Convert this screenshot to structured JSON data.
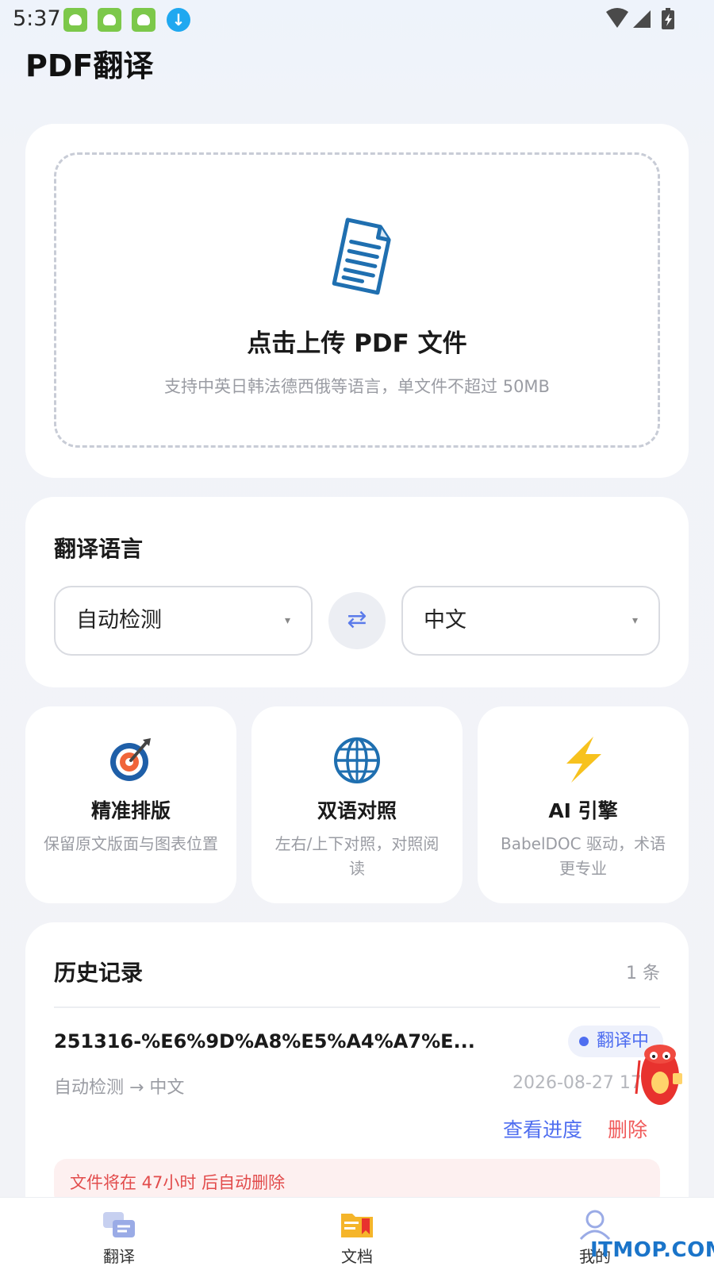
{
  "status_bar": {
    "time": "5:37"
  },
  "header": {
    "title": "PDF翻译"
  },
  "upload": {
    "title": "点击上传 PDF 文件",
    "subtitle": "支持中英日韩法德西俄等语言，单文件不超过 50MB"
  },
  "language": {
    "heading": "翻译语言",
    "source": "自动检测",
    "target": "中文",
    "caret": "▾",
    "swap_symbol": "⇄"
  },
  "features": [
    {
      "title": "精准排版",
      "desc": "保留原文版面与图表位置",
      "icon": "target-icon"
    },
    {
      "title": "双语对照",
      "desc": "左右/上下对照，对照阅读",
      "icon": "globe-icon"
    },
    {
      "title": "AI 引擎",
      "desc": "BabelDOC 驱动，术语更专业",
      "icon": "lightning-icon"
    }
  ],
  "history": {
    "title": "历史记录",
    "count": "1 条",
    "items": [
      {
        "file_name": "251316-%E6%9D%A8%E5%A4%A7%E...",
        "status": "翻译中",
        "langs": "自动检测 → 中文",
        "date": "2026-08-27 17",
        "view_label": "查看进度",
        "delete_label": "删除",
        "warning": "文件将在 47小时 后自动删除"
      }
    ]
  },
  "bottom_nav": [
    {
      "label": "翻译",
      "icon": "translate-icon"
    },
    {
      "label": "文档",
      "icon": "document-folder-icon"
    },
    {
      "label": "我的",
      "icon": "profile-icon"
    }
  ],
  "watermark": "ITMOP.COM",
  "colors": {
    "accent": "#4f6ef0",
    "danger": "#f05a5a",
    "background": "#f2f3f7",
    "card": "#ffffff"
  }
}
